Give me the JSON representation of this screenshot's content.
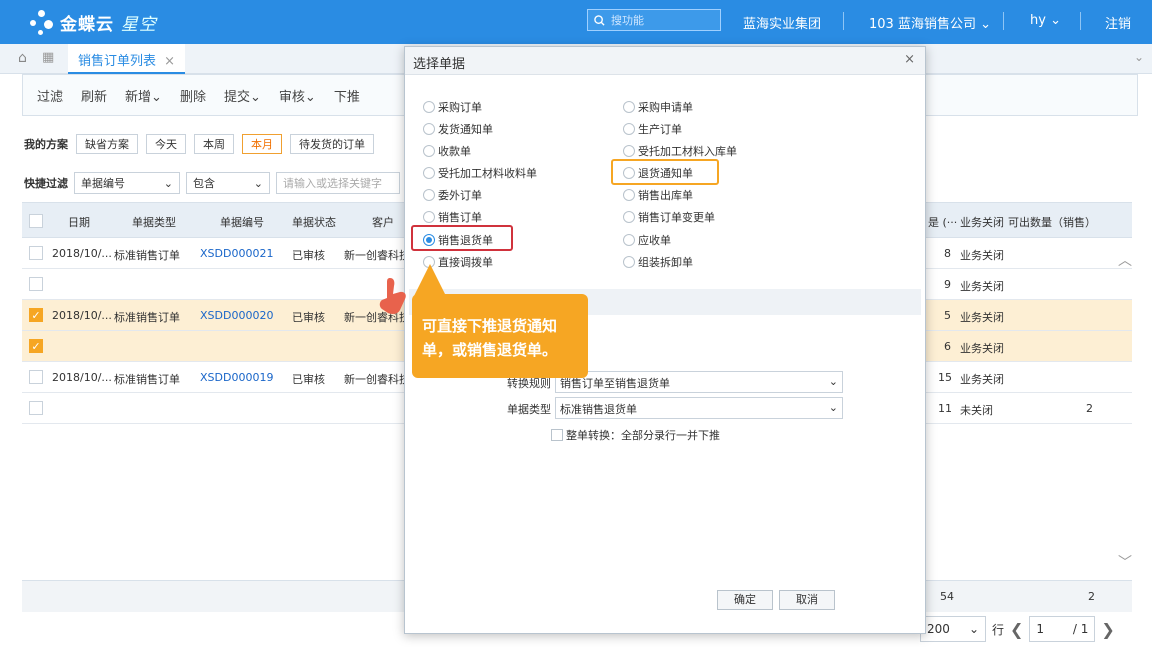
{
  "header": {
    "logo_text": "金蝶云",
    "logo_sub": "星空",
    "search_placeholder": "搜功能",
    "org_group": "蓝海实业集团",
    "company": "103 蓝海销售公司",
    "user": "hy",
    "logout": "注销"
  },
  "tabs": [
    {
      "label": "销售订单列表"
    }
  ],
  "toolbar": {
    "filter": "过滤",
    "refresh": "刷新",
    "new": "新增",
    "delete": "删除",
    "submit": "提交",
    "audit": "审核",
    "push_down": "下推"
  },
  "filters": {
    "scheme_label": "我的方案",
    "items": [
      "缺省方案",
      "今天",
      "本周",
      "本月",
      "待发货的订单"
    ]
  },
  "quick_filter": {
    "label": "快捷过滤",
    "field": "单据编号",
    "op": "包含",
    "placeholder": "请输入或选择关键字"
  },
  "table": {
    "headers": [
      "日期",
      "单据类型",
      "单据编号",
      "单据状态",
      "客户"
    ],
    "right_headers": [
      "是 (···",
      "业务关闭",
      "可出数量（销售）"
    ],
    "rows": [
      {
        "date": "2018/10/...",
        "type": "标准销售订单",
        "no": "XSDD000021",
        "status": "已审核",
        "customer": "新一创睿科技",
        "qty": "8",
        "close": "业务关闭",
        "avail": "",
        "checked": false
      },
      {
        "date": "",
        "type": "",
        "no": "",
        "status": "",
        "customer": "",
        "qty": "9",
        "close": "业务关闭",
        "avail": "",
        "checked": false
      },
      {
        "date": "2018/10/...",
        "type": "标准销售订单",
        "no": "XSDD000020",
        "status": "已审核",
        "customer": "新一创睿科技",
        "qty": "5",
        "close": "业务关闭",
        "avail": "",
        "checked": true
      },
      {
        "date": "",
        "type": "",
        "no": "",
        "status": "",
        "customer": "",
        "qty": "6",
        "close": "业务关闭",
        "avail": "",
        "checked": true
      },
      {
        "date": "2018/10/...",
        "type": "标准销售订单",
        "no": "XSDD000019",
        "status": "已审核",
        "customer": "新一创睿科技",
        "qty": "15",
        "close": "业务关闭",
        "avail": "",
        "checked": false
      },
      {
        "date": "",
        "type": "",
        "no": "",
        "status": "",
        "customer": "",
        "qty": "11",
        "close": "未关闭",
        "avail": "2",
        "checked": false
      }
    ],
    "footer_qty": "54",
    "footer_avail": "2"
  },
  "pager": {
    "page_size": "200",
    "row_label": "行",
    "page": "1",
    "total": "/ 1"
  },
  "dialog": {
    "title": "选择单据",
    "left_options": [
      "采购订单",
      "发货通知单",
      "收款单",
      "受托加工材料收料单",
      "委外订单",
      "销售订单",
      "销售退货单",
      "直接调拨单"
    ],
    "right_options": [
      "采购申请单",
      "生产订单",
      "受托加工材料入库单",
      "退货通知单",
      "销售出库单",
      "销售订单变更单",
      "应收单",
      "组装拆卸单"
    ],
    "selected": "销售退货单",
    "rule_label": "转换规则",
    "rule_value": "销售订单至销售退货单",
    "type_label": "单据类型",
    "type_value": "标准销售退货单",
    "whole_label": "整单转换：全部分录行一并下推",
    "ok": "确定",
    "cancel": "取消"
  },
  "callout": {
    "text": "可直接下推退货通知单，或销售退货单。"
  },
  "colors": {
    "brand": "#2a8ce3",
    "highlight_orange": "#f6a623",
    "highlight_red": "#d0323c"
  }
}
